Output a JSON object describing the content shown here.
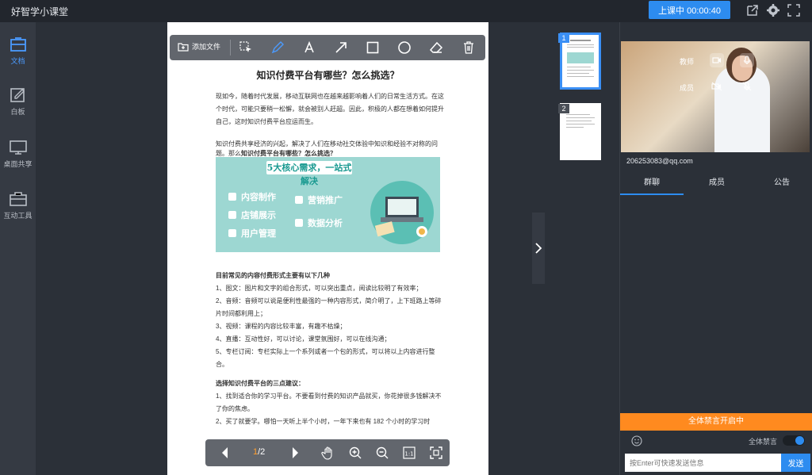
{
  "app": {
    "title": "好智学小课堂"
  },
  "header": {
    "class_status": "上课中 00:00:40"
  },
  "sidebar": {
    "items": [
      {
        "label": "文档",
        "icon": "document-icon"
      },
      {
        "label": "白板",
        "icon": "whiteboard-icon"
      },
      {
        "label": "桌面共享",
        "icon": "monitor-icon"
      },
      {
        "label": "互动工具",
        "icon": "toolbox-icon"
      }
    ]
  },
  "toolbar": {
    "add_file": "添加文件"
  },
  "document": {
    "title": "知识付费平台有哪些？怎么挑选？",
    "intro": "现如今，随着时代发展，移动互联网也在越来越影响着人们的日常生活方式。在这个时代，可能只要稍一松懈，就会被别人赶超。因此，积极的人都在想着如何提升自己，这时知识付费平台应运而生。",
    "para2_prefix": "知识付费共享经济的兴起，解决了人们在移动社交体验中知识和经验不对称的问题。那么",
    "para2_bold": "知识付费平台有哪些？怎么挑选？",
    "banner": {
      "title": "5大核心需求，一站式解决",
      "items": [
        "内容制作",
        "店铺展示",
        "用户管理",
        "营销推广",
        "数据分析"
      ]
    },
    "section1_title": "目前常见的内容付费形式主要有以下几种",
    "section1_lines": [
      "1、图文：图片和文字的组合形式，可以突出重点，阅读比较明了有效率；",
      "2、音频：音频可以说是便利性最强的一种内容形式，简介明了，上下班路上等碎片时间都利用上；",
      "3、视频：课程的内容比较丰富，有趣不枯燥；",
      "4、直播：互动性好，可以讨论，课堂氛围好，可以在线沟通；",
      "5、专栏订阅：专栏实际上一个系列或者一个包的形式，可以将以上内容进行整合。"
    ],
    "section2_title": "选择知识付费平台的三点建议：",
    "section2_lines": [
      "1、找到适合你的学习平台。不要看到付费的知识产品就买，你花掉很多钱解决不了你的焦虑。",
      "2、买了就要学。哪怕一天听上半个小时，一年下来也有 182 个小时的学习时"
    ]
  },
  "pager": {
    "current": "1",
    "total": "/2"
  },
  "thumbnails": [
    {
      "num": "1"
    },
    {
      "num": "2"
    }
  ],
  "video": {
    "teacher_label": "教师",
    "member_label": "成员",
    "user": "206253083@qq.com"
  },
  "tabs": [
    "群聊",
    "成员",
    "公告"
  ],
  "chat": {
    "mute_banner": "全体禁言开启中",
    "mute_toggle_label": "全体禁言",
    "mute_all": true,
    "input_placeholder": "按Enter可快速发送信息",
    "send": "发送"
  },
  "colors": {
    "accent": "#2d8cf0",
    "warning": "#ff8a1f",
    "banner": "#9dd7d2"
  }
}
